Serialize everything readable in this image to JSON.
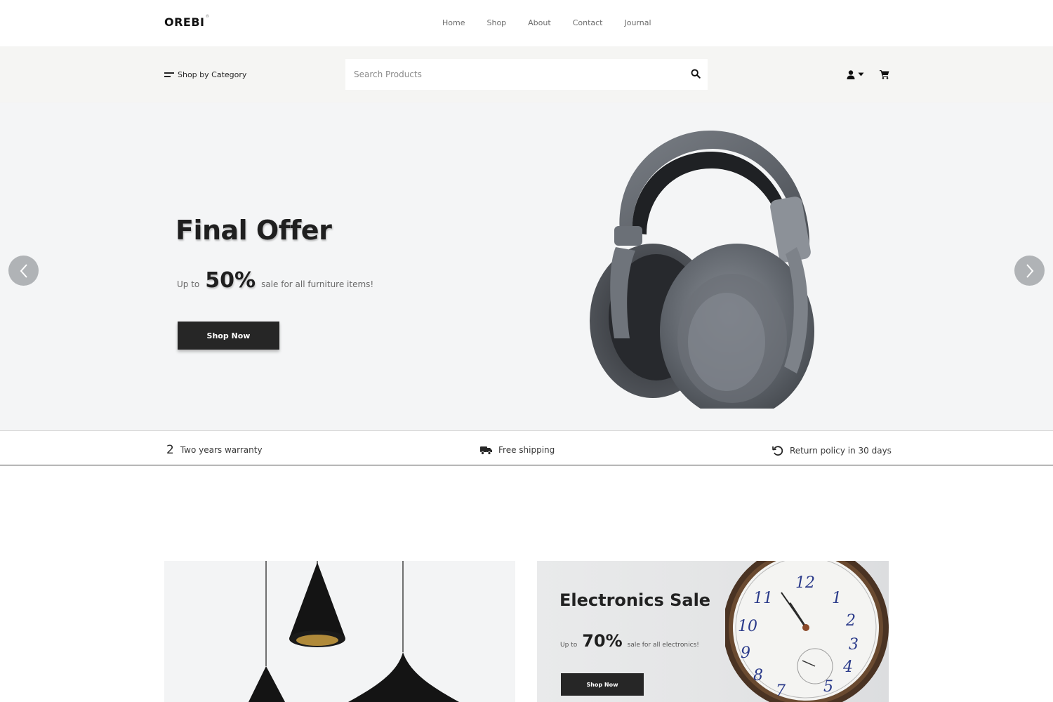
{
  "brand": {
    "logo": "OREBI",
    "logo_mark": "®"
  },
  "nav": {
    "items": [
      "Home",
      "Shop",
      "About",
      "Contact",
      "Journal"
    ]
  },
  "catbar": {
    "category_label": "Shop by Category",
    "search_placeholder": "Search Products"
  },
  "hero": {
    "title": "Final Offer",
    "offer_prefix": "Up to",
    "offer_value": "50%",
    "offer_suffix": "sale for all furniture items!",
    "button": "Shop Now"
  },
  "features": [
    {
      "num": "2",
      "label": "Two years warranty"
    },
    {
      "label": "Free shipping",
      "icon": "truck-icon"
    },
    {
      "label": "Return policy in 30 days",
      "icon": "return-icon"
    }
  ],
  "promo_electronics": {
    "title": "Electronics Sale",
    "offer_prefix": "Up to",
    "offer_value": "70%",
    "offer_suffix": "sale for all electronics!",
    "button": "Shop Now"
  },
  "colors": {
    "dark": "#262626",
    "hero_bg": "#f4f5f6",
    "catbar_bg": "#f5f5f3",
    "arrow_bg": "#b0b3b6"
  }
}
